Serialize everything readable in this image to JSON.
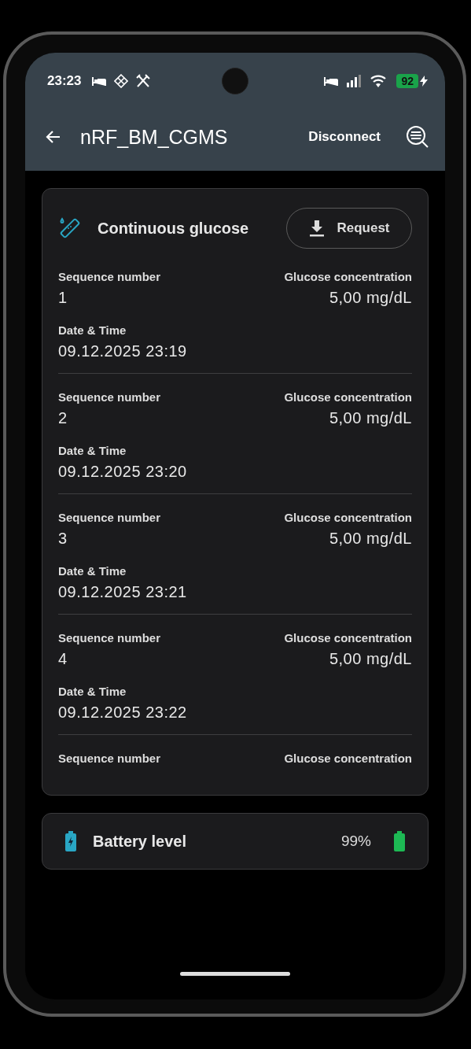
{
  "status_bar": {
    "time": "23:23",
    "battery": "92"
  },
  "toolbar": {
    "title": "nRF_BM_CGMS",
    "action": "Disconnect"
  },
  "glucose_card": {
    "title": "Continuous glucose",
    "button": "Request",
    "records": [
      {
        "seq_label": "Sequence number",
        "seq": "1",
        "conc_label": "Glucose concentration",
        "conc": "5,00 mg/dL",
        "dt_label": "Date & Time",
        "dt": "09.12.2025 23:19"
      },
      {
        "seq_label": "Sequence number",
        "seq": "2",
        "conc_label": "Glucose concentration",
        "conc": "5,00 mg/dL",
        "dt_label": "Date & Time",
        "dt": "09.12.2025 23:20"
      },
      {
        "seq_label": "Sequence number",
        "seq": "3",
        "conc_label": "Glucose concentration",
        "conc": "5,00 mg/dL",
        "dt_label": "Date & Time",
        "dt": "09.12.2025 23:21"
      },
      {
        "seq_label": "Sequence number",
        "seq": "4",
        "conc_label": "Glucose concentration",
        "conc": "5,00 mg/dL",
        "dt_label": "Date & Time",
        "dt": "09.12.2025 23:22"
      },
      {
        "seq_label": "Sequence number",
        "conc_label": "Glucose concentration"
      }
    ]
  },
  "battery_card": {
    "title": "Battery level",
    "value": "99%"
  }
}
